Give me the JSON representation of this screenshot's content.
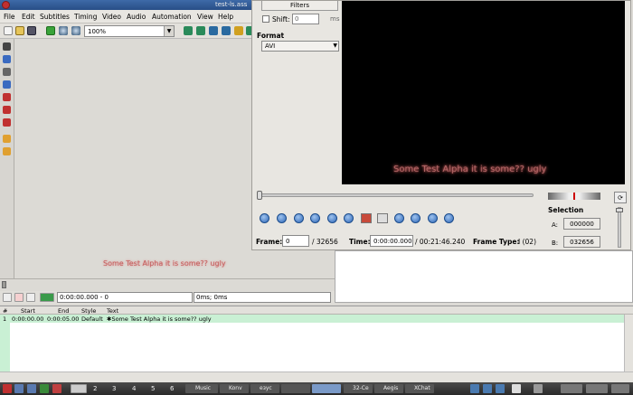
{
  "window": {
    "title": "test-ls.ass"
  },
  "menu": [
    "File",
    "Edit",
    "Subtitles",
    "Timing",
    "Video",
    "Audio",
    "Automation",
    "View",
    "Help"
  ],
  "toolbar": {
    "zoom_value": "100%"
  },
  "preview_subtitle": "Some Test Alpha it is some?? ugly",
  "transport": {
    "time_frame": "0:00:00.000 - 0",
    "offset": "0ms; 0ms"
  },
  "grid": {
    "headers": {
      "num": "#",
      "start": "Start",
      "end": "End",
      "style": "Style",
      "text": "Text"
    },
    "rows": [
      {
        "num": "1",
        "start": "0:00:00.00",
        "end": "0:00:05.00",
        "style": "Default",
        "text": "✱Some Test Alpha it is some?? ugly"
      }
    ]
  },
  "export_dialog": {
    "filters_button": "Filters",
    "shift_label": "Shift:",
    "shift_value": "0",
    "shift_unit": "ms",
    "format_label": "Format",
    "format_value": "AVI",
    "video_subtitle": "Some Test Alpha it is some?? ugly",
    "frame_label": "Frame:",
    "frame_value": "0",
    "frame_total": "/ 32656",
    "time_label": "Time:",
    "time_value": "0:00:00.000",
    "time_total": "/ 00:21:46.240",
    "frame_type_label": "Frame Type:",
    "frame_type_value": "I (02)",
    "selection_label": "Selection",
    "a_label": "A:",
    "a_value": "000000",
    "b_label": "B:",
    "b_value": "032656"
  },
  "taskbar": {
    "workspaces": [
      "2",
      "3",
      "4",
      "5",
      "6"
    ],
    "apps": [
      "Music",
      "Konv",
      "езус",
      "32-Ce",
      "Aegis",
      "XChat"
    ]
  },
  "colors": {
    "accent": "#2f68b8",
    "grid_row": "#c9f0d4",
    "subtitle": "#c04b4b",
    "close": "#c03030"
  }
}
